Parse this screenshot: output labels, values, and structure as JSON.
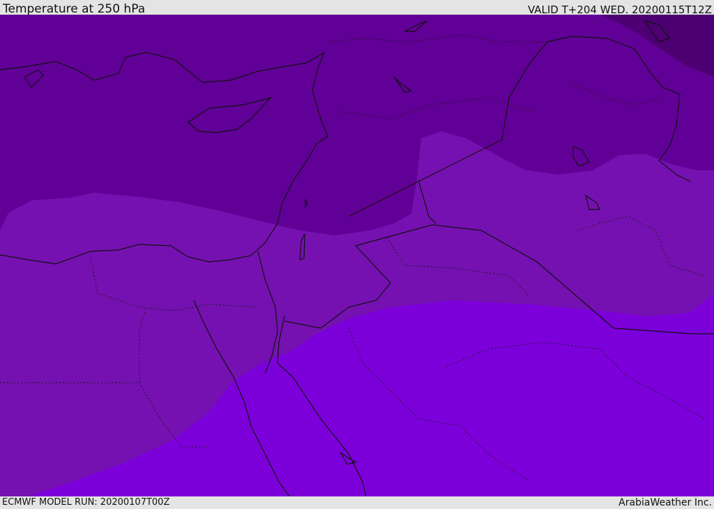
{
  "header": {
    "title": "Temperature at 250 hPa",
    "valid": "VALID T+204 WED. 20200115T12Z"
  },
  "footer": {
    "model_run": "ECMWF MODEL RUN: 20200107T00Z",
    "provider": "ArabiaWeather Inc."
  },
  "colors": {
    "coldest": "#4d0072",
    "cold": "#610096",
    "mid": "#7511b0",
    "warm": "#7c00da",
    "borders": "#111111",
    "chrome": "#e4e4e4"
  }
}
